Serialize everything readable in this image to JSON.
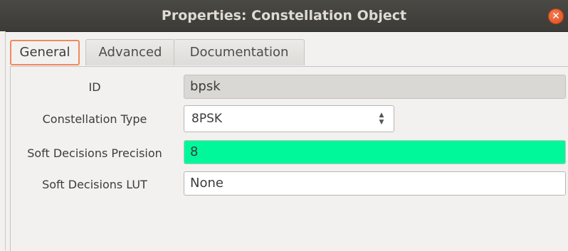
{
  "window": {
    "title": "Properties: Constellation Object",
    "close_icon": "close-icon",
    "accent_color": "#df4a16"
  },
  "tabs": [
    {
      "label": "General",
      "active": true
    },
    {
      "label": "Advanced",
      "active": false
    },
    {
      "label": "Documentation",
      "active": false
    }
  ],
  "fields": {
    "id": {
      "label": "ID",
      "value": "bpsk"
    },
    "constellation_type": {
      "label": "Constellation Type",
      "value": "8PSK"
    },
    "soft_decisions_precision": {
      "label": "Soft Decisions Precision",
      "value": "8",
      "highlight_color": "#00f89a"
    },
    "soft_decisions_lut": {
      "label": "Soft Decisions LUT",
      "value": "None"
    }
  }
}
